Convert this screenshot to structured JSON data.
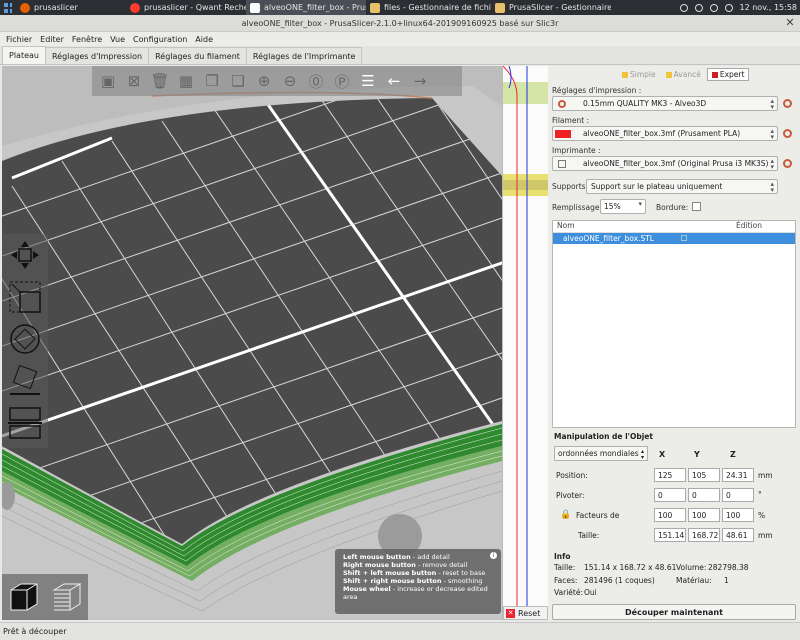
{
  "taskbar": {
    "apps": [
      {
        "label": "prusaslicer",
        "icon": "firefox-icon",
        "color": "#e66000"
      },
      {
        "label": "prusaslicer - Qwant Recherc...",
        "icon": "qwant-icon",
        "color": "#ff3b30"
      },
      {
        "label": "alveoONE_filter_box - PrusaS...",
        "icon": "prusaslicer-icon",
        "color": "#fafafa"
      },
      {
        "label": "files - Gestionnaire de fichiers",
        "icon": "folder-icon",
        "color": "#e8c06a"
      },
      {
        "label": "PrusaSlicer - Gestionnaire d...",
        "icon": "folder-icon",
        "color": "#e8c06a"
      }
    ],
    "clock": "12 nov., 15:58"
  },
  "window": {
    "title": "alveoONE_filter_box - PrusaSlicer-2.1.0+linux64-201909160925 basé sur Slic3r"
  },
  "menu": [
    "Fichier",
    "Editer",
    "Fenêtre",
    "Vue",
    "Configuration",
    "Aide"
  ],
  "tabs": [
    "Plateau",
    "Réglages d'Impression",
    "Réglages du filament",
    "Réglages de l'Imprimante"
  ],
  "modes": [
    {
      "label": "Simple",
      "color": "#f0c43a"
    },
    {
      "label": "Avancé",
      "color": "#f0c43a"
    },
    {
      "label": "Expert",
      "color": "#cc1f1f"
    }
  ],
  "print_settings": {
    "label": "Réglages d'impression :",
    "value": "0.15mm QUALITY MK3 - Alveo3D"
  },
  "filament": {
    "label": "Filament :",
    "value": "alveoONE_filter_box.3mf (Prusament PLA)",
    "color": "#ee2222"
  },
  "printer": {
    "label": "Imprimante :",
    "value": "alveoONE_filter_box.3mf (Original Prusa i3 MK3S)"
  },
  "supports": {
    "label": "Supports:",
    "value": "Support sur le plateau uniquement"
  },
  "infill": {
    "label": "Remplissage:",
    "value": "15%"
  },
  "brim": {
    "label": "Bordure:"
  },
  "object_list": {
    "col_name": "Nom",
    "col_edit": "Édition",
    "rows": [
      "alveoONE_filter_box.STL"
    ]
  },
  "manipulation": {
    "title": "Manipulation de l'Objet",
    "coords": "ordonnées mondiales",
    "axes": [
      "X",
      "Y",
      "Z"
    ],
    "position": {
      "label": "Position:",
      "values": [
        "125",
        "105",
        "24.31"
      ],
      "unit": "mm"
    },
    "rotate": {
      "label": "Pivoter:",
      "values": [
        "0",
        "0",
        "0"
      ],
      "unit": "°"
    },
    "scale": {
      "label": "Facteurs de",
      "values": [
        "100",
        "100",
        "100"
      ],
      "unit": "%"
    },
    "size": {
      "label": "Taille:",
      "values": [
        "151.14",
        "168.72",
        "48.61"
      ],
      "unit": "mm"
    }
  },
  "info": {
    "title": "Info",
    "size_label": "Taille:",
    "size": "151.14 x 168.72 x 48.61",
    "volume_label": "Volume:",
    "volume": "282798.38",
    "faces_label": "Faces:",
    "faces": "281496 (1 coques)",
    "material_label": "Matériau:",
    "material": "1",
    "variety_label": "Variété:",
    "variety": "Oui"
  },
  "slice_button": "Découper maintenant",
  "reset_button": "Reset",
  "hint": {
    "l1b": "Left mouse button",
    "l1": " - add detail",
    "l2b": "Right mouse button",
    "l2": " - remove detail",
    "l3b": "Shift + left mouse button",
    "l3": " - reset to base",
    "l4b": "Shift + right mouse button",
    "l4": " - smoothing",
    "l5b": "Mouse wheel",
    "l5": " - increase or decrease edited area"
  },
  "status": "Prêt à découper"
}
